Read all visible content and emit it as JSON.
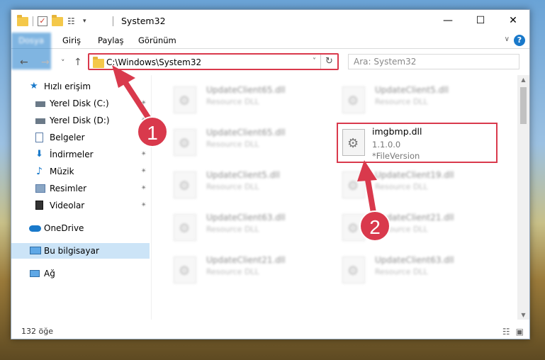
{
  "window": {
    "title": "System32",
    "controls": {
      "minimize": "—",
      "maximize": "☐",
      "close": "✕"
    }
  },
  "ribbon": {
    "tabs": [
      "Dosya",
      "Giriş",
      "Paylaş",
      "Görünüm"
    ],
    "help_glyph": "?",
    "expand_glyph": "∨"
  },
  "navigation": {
    "back_glyph": "←",
    "forward_glyph": "→",
    "recent_glyph": "˅",
    "up_glyph": "↑",
    "address": "C:\\Windows\\System32",
    "address_dropdown": "˅",
    "refresh_glyph": "↻",
    "search_placeholder": "Ara: System32"
  },
  "sidebar": {
    "items": [
      {
        "label": "Hızlı erişim",
        "icon": "star-icon",
        "pinned": false
      },
      {
        "label": "Yerel Disk (C:)",
        "icon": "drive-icon",
        "pinned": true
      },
      {
        "label": "Yerel Disk (D:)",
        "icon": "drive-icon",
        "pinned": true
      },
      {
        "label": "Belgeler",
        "icon": "documents-icon",
        "pinned": true
      },
      {
        "label": "İndirmeler",
        "icon": "downloads-icon",
        "pinned": true
      },
      {
        "label": "Müzik",
        "icon": "music-icon",
        "pinned": true
      },
      {
        "label": "Resimler",
        "icon": "pictures-icon",
        "pinned": true
      },
      {
        "label": "Videolar",
        "icon": "videos-icon",
        "pinned": true
      },
      {
        "label": "OneDrive",
        "icon": "cloud-icon",
        "pinned": false
      },
      {
        "label": "Bu bilgisayar",
        "icon": "computer-icon",
        "pinned": false,
        "selected": true
      },
      {
        "label": "Ağ",
        "icon": "network-icon",
        "pinned": false
      }
    ],
    "pin_glyph": "✴"
  },
  "files": [
    {
      "name": "UpdateClient65.dll",
      "desc": "Resource DLL"
    },
    {
      "name": "UpdateClient5.dll",
      "desc": "Resource DLL"
    },
    {
      "name": "UpdateClient65.dll",
      "desc": "Resource DLL"
    },
    {
      "name": "UpdateClient5.dll",
      "desc": "Resource DLL"
    },
    {
      "name": "UpdateClient19.dll",
      "desc": "Resource DLL"
    },
    {
      "name": "UpdateClient63.dll",
      "desc": "Resource DLL"
    },
    {
      "name": "UpdateClient21.dll",
      "desc": "Resource DLL"
    },
    {
      "name": "UpdateClient21.dll",
      "desc": "Resource DLL"
    },
    {
      "name": "UpdateClient63.dll",
      "desc": "Resource DLL"
    }
  ],
  "highlighted_file": {
    "name": "imgbmp.dll",
    "version": "1.1.0.0",
    "info": "*FileVersion"
  },
  "status": {
    "count": "132 öğe",
    "details_view_glyph": "☷",
    "tiles_view_glyph": "▣"
  },
  "annotations": {
    "badge_1": "1",
    "badge_2": "2",
    "color": "#d9394c"
  }
}
